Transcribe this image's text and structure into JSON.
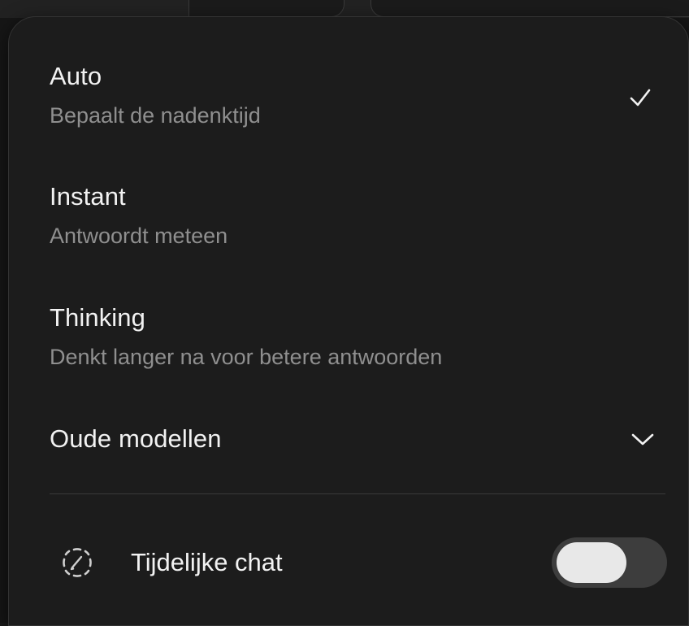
{
  "menu": {
    "options": [
      {
        "title": "Auto",
        "description": "Bepaalt de nadenktijd",
        "selected": true
      },
      {
        "title": "Instant",
        "description": "Antwoordt meteen",
        "selected": false
      },
      {
        "title": "Thinking",
        "description": "Denkt langer na voor betere antwoorden",
        "selected": false
      }
    ],
    "legacy": {
      "label": "Oude modellen",
      "icon": "chevron-down-icon"
    },
    "temporary_chat": {
      "label": "Tijdelijke chat",
      "icon": "temporary-chat-icon",
      "enabled": false
    }
  },
  "colors": {
    "background": "#1c1c1c",
    "text_primary": "#f2f2f2",
    "text_secondary": "#8f8f8f",
    "toggle_track": "#3d3d3d",
    "toggle_knob": "#e8e8e8"
  }
}
